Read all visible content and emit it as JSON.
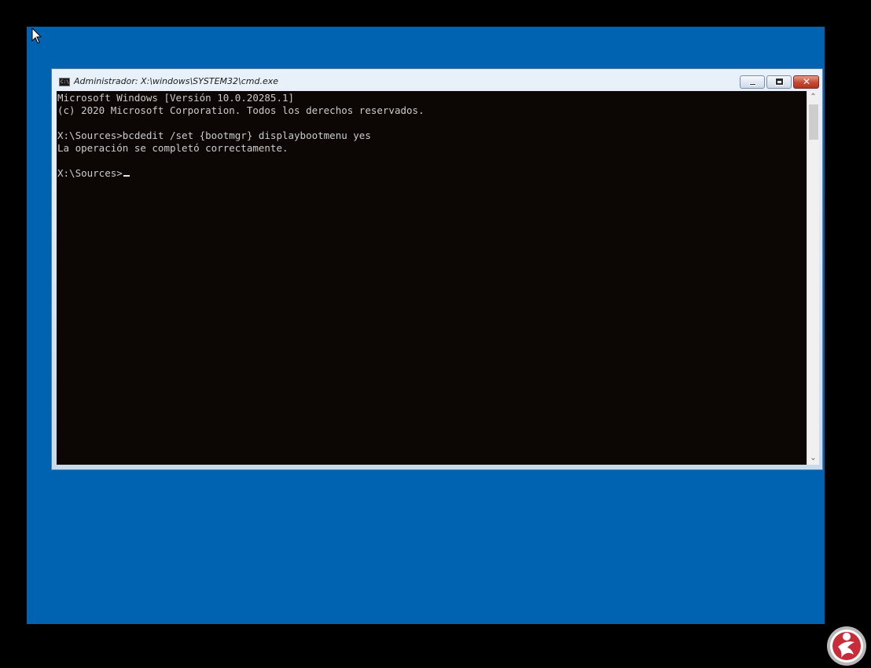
{
  "window": {
    "title": "Administrador: X:\\windows\\SYSTEM32\\cmd.exe",
    "icon_label": "C:\\"
  },
  "icons": {
    "app": "cmd-icon",
    "minimize": "minimize-icon",
    "maximize": "maximize-icon",
    "close": "close-icon",
    "cursor": "mouse-pointer-icon",
    "badge": "person-logo-icon"
  },
  "console": {
    "lines": [
      "Microsoft Windows [Versión 10.0.20285.1]",
      "(c) 2020 Microsoft Corporation. Todos los derechos reservados.",
      "",
      "X:\\Sources>bcdedit /set {bootmgr} displaybootmenu yes",
      "La operación se completó correctamente.",
      "",
      "X:\\Sources>"
    ]
  },
  "colors": {
    "desktop": "#0063b1",
    "console_bg": "#0c0704",
    "console_text": "#cccccc",
    "close_button": "#c34a32"
  }
}
